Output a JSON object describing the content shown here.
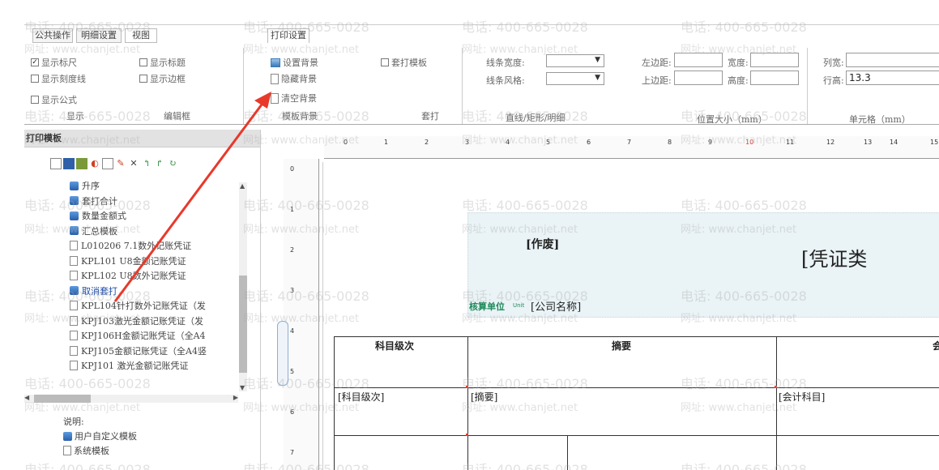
{
  "ribbon": {
    "tabs": [
      "公共操作",
      "明细设置",
      "视图",
      "打印设置"
    ],
    "display_group": {
      "checkboxes": [
        {
          "label": "显示标尺",
          "checked": true
        },
        {
          "label": "显示标题",
          "checked": false
        },
        {
          "label": "显示刻度线",
          "checked": false
        },
        {
          "label": "显示边框",
          "checked": false
        },
        {
          "label": "显示公式",
          "checked": false
        }
      ],
      "label": "显示",
      "edit_label": "编辑框"
    },
    "template_bg_group": {
      "set_bg": "设置背景",
      "hide_bg": "隐藏背景",
      "clear_bg": "清空背景",
      "label": "模板背景"
    },
    "overprint_group": {
      "checkbox": "套打模板",
      "label": "套打"
    },
    "line_group": {
      "width_label": "线条宽度:",
      "style_label": "线条风格:",
      "label": "直线/矩形/明细"
    },
    "position_group": {
      "left_label": "左边距:",
      "top_label": "上边距:",
      "width_label": "宽度:",
      "height_label": "高度:",
      "label": "位置大小（mm）"
    },
    "cell_group": {
      "col_width_label": "列宽:",
      "row_height_label": "行高:",
      "row_height_value": "13.3",
      "label": "单元格（mm）"
    }
  },
  "left_panel": {
    "title": "打印模板",
    "tree_items": [
      {
        "label": "升序",
        "icon": "user-icon"
      },
      {
        "label": "套打合计",
        "icon": "user-icon"
      },
      {
        "label": "数量金额式",
        "icon": "user-icon"
      },
      {
        "label": "汇总模板",
        "icon": "user-icon"
      },
      {
        "label": "L010206 7.1数外记账凭证",
        "icon": "doc-icon"
      },
      {
        "label": "KPL101 U8金额记账凭证",
        "icon": "doc-icon"
      },
      {
        "label": "KPL102 U8数外记账凭证",
        "icon": "doc-icon"
      },
      {
        "label": "取消套打",
        "icon": "user-icon",
        "selected": true
      },
      {
        "label": "KPL104针打数外记账凭证（发",
        "icon": "doc-icon"
      },
      {
        "label": "KPJ103激光金额记账凭证（发",
        "icon": "doc-icon"
      },
      {
        "label": "KPJ106H金额记账凭证（全A4",
        "icon": "doc-icon"
      },
      {
        "label": "KPJ105金额记账凭证（全A4竖",
        "icon": "doc-icon"
      },
      {
        "label": "KPJ101 激光金额记账凭证",
        "icon": "doc-icon"
      }
    ],
    "legend_title": "说明:",
    "legend_items": [
      "用户自定义模板",
      "系统模板"
    ]
  },
  "rulers": {
    "h_labels": [
      "0",
      "1",
      "2",
      "3",
      "4",
      "5",
      "6",
      "7",
      "8",
      "9",
      "10",
      "11",
      "12",
      "13",
      "14",
      "15"
    ],
    "v_labels": [
      "0",
      "1",
      "2",
      "3",
      "4",
      "5",
      "6",
      "7"
    ]
  },
  "canvas": {
    "void": "[作废]",
    "voucher_type": "[凭证类",
    "unit_label": "核算单位",
    "unit_small": "Unit",
    "company": "[公司名称]",
    "col_headers": [
      "科目级次",
      "摘要",
      "会"
    ],
    "row_values": [
      "[科目级次]",
      "[摘要]",
      "[会计科目]"
    ]
  },
  "watermark": {
    "phone": "电话: 400-665-0028",
    "url": "网址: www.chanjet.net"
  },
  "colors": {
    "accent": "#e8392b",
    "title_bg": "#eaf3f6",
    "unit_label": "#1e8a5a"
  }
}
